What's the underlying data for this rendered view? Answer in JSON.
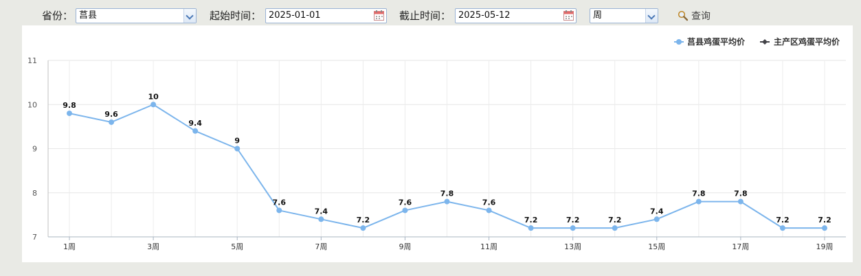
{
  "filters": {
    "province_label": "省份：",
    "province_value": "莒县",
    "start_label": "起始时间：",
    "start_value": "2025-01-01",
    "end_label": "截止时间：",
    "end_value": "2025-05-12",
    "period_value": "周",
    "search_label": "查询"
  },
  "colors": {
    "series_local": "#7cb5ec",
    "series_main": "#434348",
    "page_bg": "#e9eae5"
  },
  "chart_data": {
    "type": "line",
    "x": [
      1,
      2,
      3,
      4,
      5,
      6,
      7,
      8,
      9,
      10,
      11,
      12,
      13,
      14,
      15,
      16,
      17,
      18,
      19
    ],
    "xticks": [
      {
        "x": 1,
        "label": "1周"
      },
      {
        "x": 3,
        "label": "3周"
      },
      {
        "x": 5,
        "label": "5周"
      },
      {
        "x": 7,
        "label": "7周"
      },
      {
        "x": 9,
        "label": "9周"
      },
      {
        "x": 11,
        "label": "11周"
      },
      {
        "x": 13,
        "label": "13周"
      },
      {
        "x": 15,
        "label": "15周"
      },
      {
        "x": 17,
        "label": "17周"
      },
      {
        "x": 19,
        "label": "19周"
      }
    ],
    "yticks": [
      7,
      8,
      9,
      10,
      11
    ],
    "ylim": [
      7,
      11
    ],
    "grid": true,
    "legend_position": "top-right",
    "series": [
      {
        "name": "莒县鸡蛋平均价",
        "values": [
          9.8,
          9.6,
          10,
          9.4,
          9,
          7.6,
          7.4,
          7.2,
          7.6,
          7.8,
          7.6,
          7.2,
          7.2,
          7.2,
          7.4,
          7.8,
          7.8,
          7.2,
          7.2
        ],
        "labels": [
          "9.8",
          "9.6",
          "10",
          "9.4",
          "9",
          "7.6",
          "7.4",
          "7.2",
          "7.6",
          "7.8",
          "7.6",
          "7.2",
          "7.2",
          "7.2",
          "7.4",
          "7.8",
          "7.8",
          "7.2",
          "7.2"
        ]
      },
      {
        "name": "主产区鸡蛋平均价",
        "values": []
      }
    ]
  }
}
